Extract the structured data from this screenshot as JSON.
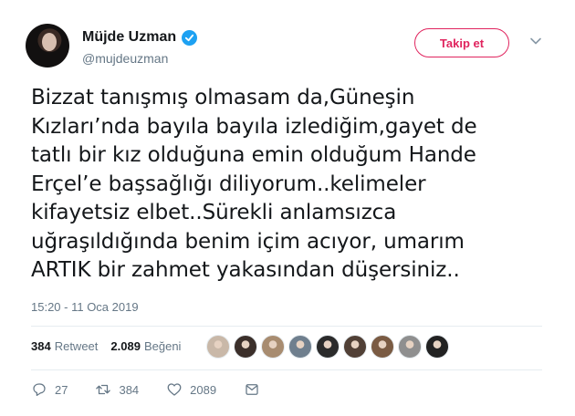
{
  "user": {
    "name": "Müjde Uzman",
    "handle": "@mujdeuzman"
  },
  "follow_label": "Takip et",
  "tweet": {
    "lines": [
      "Bizzat tanışmış olmasam da,Güneşin",
      "Kızları’nda bayıla bayıla izlediğim,gayet de",
      "tatlı bir kız olduğuna emin olduğum Hande",
      "Erçel’e başsağlığı diliyorum..kelimeler",
      "kifayetsiz elbet..Sürekli anlamsızca",
      "uğraşıldığında benim içim acıyor, umarım",
      "ARTIK bir zahmet yakasından düşersiniz.."
    ],
    "timestamp": "15:20 - 11 Oca 2019"
  },
  "stats": {
    "retweet_count": "384",
    "retweet_label": "Retweet",
    "like_count": "2.089",
    "like_label": "Beğeni"
  },
  "likers": [
    "#c9b8a8",
    "#3b2f2a",
    "#a88c70",
    "#6f7f8e",
    "#2b2b2b",
    "#514036",
    "#7a5b43",
    "#8f8f8f",
    "#222222"
  ],
  "actions": {
    "reply_count": "27",
    "retweet_count": "384",
    "like_count": "2089"
  },
  "icons": [
    "verified-badge-icon",
    "chevron-down-icon",
    "reply-icon",
    "retweet-icon",
    "heart-icon",
    "message-icon"
  ],
  "colors": {
    "accent_pink": "#e0245e",
    "verified_blue": "#1da1f2",
    "muted": "#657786"
  }
}
